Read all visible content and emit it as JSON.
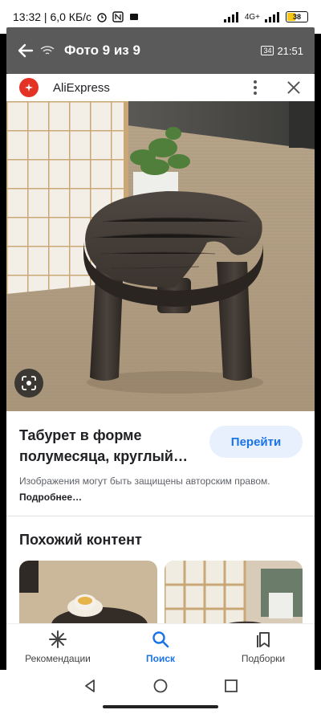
{
  "status_bar": {
    "time_and_speed": "13:32 | 6,0 КБ/с",
    "network_label": "4G+",
    "battery_level": "38"
  },
  "viewer": {
    "title": "Фото 9 из 9",
    "sim_badge": "34",
    "time": "21:51"
  },
  "source": {
    "name": "AliExpress"
  },
  "product": {
    "title_line1": "Табурет в форме",
    "title_line2": "полумесяца, круглый…",
    "go_label": "Перейти"
  },
  "copyright": {
    "text": "Изображения могут быть защищены авторским правом.",
    "more_label": "Подробнее…"
  },
  "similar": {
    "title": "Похожий контент"
  },
  "bottom_nav": {
    "items": [
      {
        "label": "Рекомендации",
        "icon": "asterisk-icon"
      },
      {
        "label": "Поиск",
        "icon": "search-icon"
      },
      {
        "label": "Подборки",
        "icon": "bookmarks-icon"
      }
    ]
  },
  "colors": {
    "accent": "#1a73e8",
    "aliexpress": "#e43225",
    "viewer_bar": "#5a5a5a"
  }
}
